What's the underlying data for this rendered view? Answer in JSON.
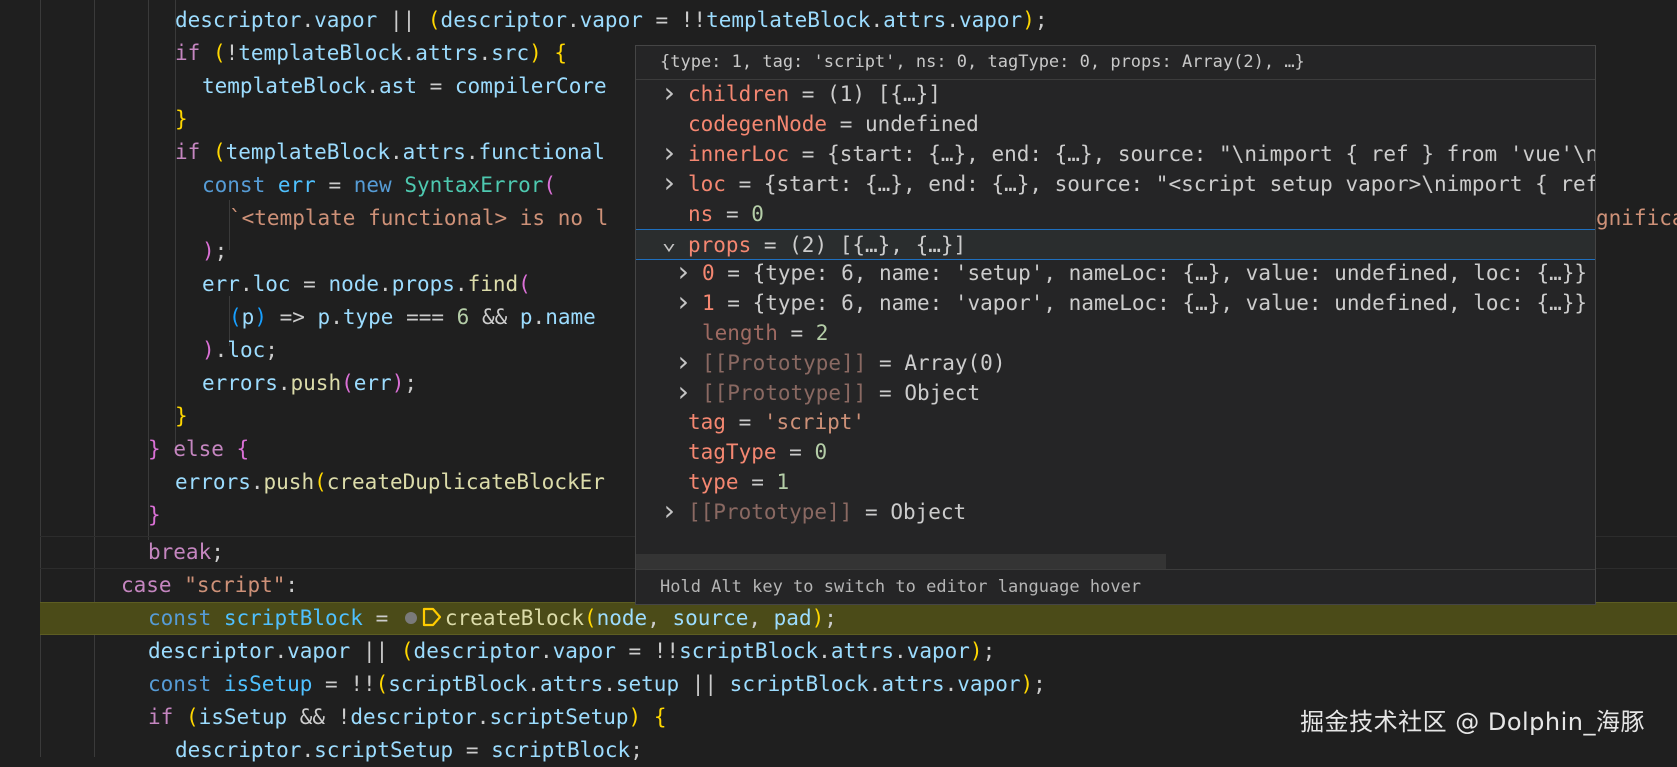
{
  "editor": {
    "lines": [
      [
        [
          "descriptor",
          "var"
        ],
        [
          ".",
          ""
        ],
        [
          "vapor",
          "var"
        ],
        [
          " || ",
          ""
        ],
        [
          "(",
          "b1"
        ],
        [
          "descriptor",
          "var"
        ],
        [
          ".",
          ""
        ],
        [
          "vapor",
          "var"
        ],
        [
          " = !!",
          ""
        ],
        [
          "templateBlock",
          "var"
        ],
        [
          ".",
          ""
        ],
        [
          "attrs",
          "var"
        ],
        [
          ".",
          ""
        ],
        [
          "vapor",
          "var"
        ],
        [
          ")",
          "b1"
        ],
        [
          ";",
          ""
        ]
      ],
      [
        [
          "if",
          "kw"
        ],
        [
          " ",
          ""
        ],
        [
          "(",
          "b1"
        ],
        [
          "!",
          ""
        ],
        [
          "templateBlock",
          "var"
        ],
        [
          ".",
          ""
        ],
        [
          "attrs",
          "var"
        ],
        [
          ".",
          ""
        ],
        [
          "src",
          "var"
        ],
        [
          ")",
          "b1"
        ],
        [
          " ",
          ""
        ],
        [
          "{",
          "b1"
        ]
      ],
      [
        [
          "templateBlock",
          "var"
        ],
        [
          ".",
          ""
        ],
        [
          "ast",
          "var"
        ],
        [
          " = ",
          ""
        ],
        [
          "compilerCore",
          "var"
        ]
      ],
      [
        [
          "}",
          "b1"
        ]
      ],
      [
        [
          "if",
          "kw"
        ],
        [
          " ",
          ""
        ],
        [
          "(",
          "b1"
        ],
        [
          "templateBlock",
          "var"
        ],
        [
          ".",
          ""
        ],
        [
          "attrs",
          "var"
        ],
        [
          ".",
          ""
        ],
        [
          "functional",
          "var"
        ]
      ],
      [
        [
          "const",
          "st"
        ],
        [
          " ",
          ""
        ],
        [
          "err",
          "cst"
        ],
        [
          " = ",
          ""
        ],
        [
          "new",
          "st"
        ],
        [
          " ",
          ""
        ],
        [
          "SyntaxError",
          "cls"
        ],
        [
          "(",
          "b2"
        ]
      ],
      [
        [
          "`<template functional> is no l",
          "str"
        ]
      ],
      [
        [
          ")",
          "b2"
        ],
        [
          ";",
          ""
        ]
      ],
      [
        [
          "err",
          "var"
        ],
        [
          ".",
          ""
        ],
        [
          "loc",
          "var"
        ],
        [
          " = ",
          ""
        ],
        [
          "node",
          "var"
        ],
        [
          ".",
          ""
        ],
        [
          "props",
          "var"
        ],
        [
          ".",
          ""
        ],
        [
          "find",
          "fn"
        ],
        [
          "(",
          "b2"
        ]
      ],
      [
        [
          "(",
          "b3"
        ],
        [
          "p",
          "var"
        ],
        [
          ")",
          "b3"
        ],
        [
          " => ",
          ""
        ],
        [
          "p",
          "var"
        ],
        [
          ".",
          ""
        ],
        [
          "type",
          "var"
        ],
        [
          " === ",
          ""
        ],
        [
          "6",
          "num"
        ],
        [
          " && ",
          ""
        ],
        [
          "p",
          "var"
        ],
        [
          ".",
          ""
        ],
        [
          "name",
          "var"
        ]
      ],
      [
        [
          ")",
          "b2"
        ],
        [
          ".",
          ""
        ],
        [
          "loc",
          "var"
        ],
        [
          ";",
          ""
        ]
      ],
      [
        [
          "errors",
          "var"
        ],
        [
          ".",
          ""
        ],
        [
          "push",
          "fn"
        ],
        [
          "(",
          "b2"
        ],
        [
          "err",
          "var"
        ],
        [
          ")",
          "b2"
        ],
        [
          ";",
          ""
        ]
      ],
      [
        [
          "}",
          "b1"
        ]
      ],
      [
        [
          "}",
          "b2"
        ],
        [
          " ",
          ""
        ],
        [
          "else",
          "kw"
        ],
        [
          " ",
          ""
        ],
        [
          "{",
          "b2"
        ]
      ],
      [
        [
          "errors",
          "var"
        ],
        [
          ".",
          ""
        ],
        [
          "push",
          "fn"
        ],
        [
          "(",
          "b1"
        ],
        [
          "createDuplicateBlockEr",
          "fn"
        ]
      ],
      [
        [
          "}",
          "b2"
        ]
      ],
      [
        [
          "break",
          "kw"
        ],
        [
          ";",
          ""
        ]
      ],
      [
        [
          "case",
          "kw"
        ],
        [
          " ",
          ""
        ],
        [
          "\"script\"",
          "str"
        ],
        [
          ":",
          ""
        ]
      ],
      [
        [
          "const",
          "st"
        ],
        [
          " ",
          ""
        ],
        [
          "scriptBlock",
          "cst"
        ],
        [
          " = ",
          ""
        ],
        [
          "createBlock",
          "fn"
        ],
        [
          "(",
          "b1"
        ],
        [
          "node",
          "var"
        ],
        [
          ", ",
          ""
        ],
        [
          "source",
          "var"
        ],
        [
          ", ",
          ""
        ],
        [
          "pad",
          "var"
        ],
        [
          ")",
          "b1"
        ],
        [
          ";",
          ""
        ]
      ],
      [
        [
          "descriptor",
          "var"
        ],
        [
          ".",
          ""
        ],
        [
          "vapor",
          "var"
        ],
        [
          " || ",
          ""
        ],
        [
          "(",
          "b1"
        ],
        [
          "descriptor",
          "var"
        ],
        [
          ".",
          ""
        ],
        [
          "vapor",
          "var"
        ],
        [
          " = !!",
          ""
        ],
        [
          "scriptBlock",
          "var"
        ],
        [
          ".",
          ""
        ],
        [
          "attrs",
          "var"
        ],
        [
          ".",
          ""
        ],
        [
          "vapor",
          "var"
        ],
        [
          ")",
          "b1"
        ],
        [
          ";",
          ""
        ]
      ],
      [
        [
          "const",
          "st"
        ],
        [
          " ",
          ""
        ],
        [
          "isSetup",
          "cst"
        ],
        [
          " = !!",
          ""
        ],
        [
          "(",
          "b1"
        ],
        [
          "scriptBlock",
          "var"
        ],
        [
          ".",
          ""
        ],
        [
          "attrs",
          "var"
        ],
        [
          ".",
          ""
        ],
        [
          "setup",
          "var"
        ],
        [
          " || ",
          ""
        ],
        [
          "scriptBlock",
          "var"
        ],
        [
          ".",
          ""
        ],
        [
          "attrs",
          "var"
        ],
        [
          ".",
          ""
        ],
        [
          "vapor",
          "var"
        ],
        [
          ")",
          "b1"
        ],
        [
          ";",
          ""
        ]
      ],
      [
        [
          "if",
          "kw"
        ],
        [
          " ",
          ""
        ],
        [
          "(",
          "b1"
        ],
        [
          "isSetup",
          "var"
        ],
        [
          " && !",
          ""
        ],
        [
          "descriptor",
          "var"
        ],
        [
          ".",
          ""
        ],
        [
          "scriptSetup",
          "var"
        ],
        [
          ")",
          "b1"
        ],
        [
          " ",
          ""
        ],
        [
          "{",
          "b1"
        ]
      ],
      [
        [
          "descriptor",
          "var"
        ],
        [
          ".",
          ""
        ],
        [
          "scriptSetup",
          "var"
        ],
        [
          " = ",
          ""
        ],
        [
          "scriptBlock",
          "var"
        ],
        [
          ";",
          ""
        ]
      ]
    ],
    "overflow_text": "gnifica"
  },
  "hover": {
    "header": "{type: 1, tag: 'script', ns: 0, tagType: 0, props: Array(2), …}",
    "rows": [
      {
        "name": "children",
        "value": "(1) [{…}]",
        "chevron": "right"
      },
      {
        "name": "codegenNode",
        "value": "undefined",
        "chevron": ""
      },
      {
        "name": "innerLoc",
        "value": "{start: {…}, end: {…}, source: \"\\nimport { ref } from 'vue'\\nc",
        "chevron": "right"
      },
      {
        "name": "loc",
        "value": "{start: {…}, end: {…}, source: \"<script setup vapor>\\nimport { ref",
        "chevron": "right"
      },
      {
        "name": "ns",
        "value": "0",
        "chevron": ""
      },
      {
        "name": "props",
        "value": "(2) [{…}, {…}]",
        "chevron": "down"
      },
      {
        "name": "0",
        "value": "{type: 6, name: 'setup', nameLoc: {…}, value: undefined, loc: {…}}",
        "chevron": "right"
      },
      {
        "name": "1",
        "value": "{type: 6, name: 'vapor', nameLoc: {…}, value: undefined, loc: {…}}",
        "chevron": "right"
      },
      {
        "name": "length",
        "value": "2",
        "chevron": ""
      },
      {
        "name": "[[Prototype]]",
        "value": "Array(0)",
        "chevron": "right"
      },
      {
        "name": "[[Prototype]]",
        "value": "Object",
        "chevron": "right"
      },
      {
        "name": "tag",
        "value": "'script'",
        "chevron": ""
      },
      {
        "name": "tagType",
        "value": "0",
        "chevron": ""
      },
      {
        "name": "type",
        "value": "1",
        "chevron": ""
      },
      {
        "name": "[[Prototype]]",
        "value": "Object",
        "chevron": "right"
      }
    ],
    "footer": "Hold Alt key to switch to editor language hover"
  },
  "watermark": "掘金技术社区 @ Dolphin_海豚",
  "colors": {
    "editor_bg": "#1f1f1f",
    "current_line": "#4b4b18",
    "hover_bg": "#252526",
    "property_name": "#f48771"
  }
}
